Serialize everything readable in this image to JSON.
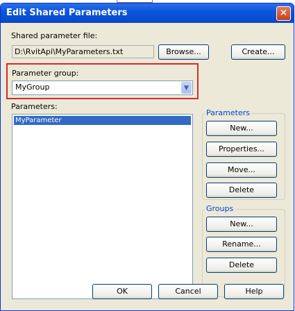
{
  "window": {
    "title": "Edit Shared Parameters"
  },
  "file": {
    "label": "Shared parameter file:",
    "path": "D:\\RvitApi\\MyParameters.txt",
    "browse": "Browse...",
    "create": "Create..."
  },
  "group": {
    "label": "Parameter group:",
    "selected": "MyGroup"
  },
  "parameters": {
    "label": "Parameters:",
    "items": [
      "MyParameter"
    ]
  },
  "param_box": {
    "label": "Parameters",
    "new": "New...",
    "properties": "Properties...",
    "move": "Move...",
    "delete": "Delete"
  },
  "groups_box": {
    "label": "Groups",
    "new": "New...",
    "rename": "Rename...",
    "delete": "Delete"
  },
  "footer": {
    "ok": "OK",
    "cancel": "Cancel",
    "help": "Help"
  }
}
